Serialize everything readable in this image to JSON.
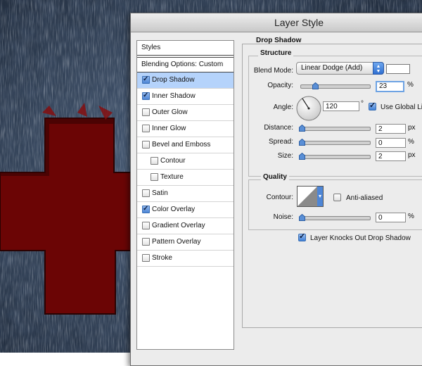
{
  "dialog": {
    "title": "Layer Style"
  },
  "styles_list": {
    "header": "Styles",
    "blending_options": "Blending Options: Custom",
    "items": [
      {
        "label": "Drop Shadow",
        "checked": true,
        "selected": true,
        "indent": false
      },
      {
        "label": "Inner Shadow",
        "checked": true,
        "selected": false,
        "indent": false
      },
      {
        "label": "Outer Glow",
        "checked": false,
        "selected": false,
        "indent": false
      },
      {
        "label": "Inner Glow",
        "checked": false,
        "selected": false,
        "indent": false
      },
      {
        "label": "Bevel and Emboss",
        "checked": false,
        "selected": false,
        "indent": false
      },
      {
        "label": "Contour",
        "checked": false,
        "selected": false,
        "indent": true
      },
      {
        "label": "Texture",
        "checked": false,
        "selected": false,
        "indent": true
      },
      {
        "label": "Satin",
        "checked": false,
        "selected": false,
        "indent": false
      },
      {
        "label": "Color Overlay",
        "checked": true,
        "selected": false,
        "indent": false
      },
      {
        "label": "Gradient Overlay",
        "checked": false,
        "selected": false,
        "indent": false
      },
      {
        "label": "Pattern Overlay",
        "checked": false,
        "selected": false,
        "indent": false
      },
      {
        "label": "Stroke",
        "checked": false,
        "selected": false,
        "indent": false
      }
    ]
  },
  "drop_shadow": {
    "section_title": "Drop Shadow",
    "structure": {
      "title": "Structure",
      "blend_mode_label": "Blend Mode:",
      "blend_mode_value": "Linear Dodge (Add)",
      "shadow_color": "#ffffff",
      "opacity_label": "Opacity:",
      "opacity_value": "23",
      "opacity_unit": "%",
      "angle_label": "Angle:",
      "angle_value": "120",
      "angle_unit": "°",
      "use_global_light_label": "Use Global Li",
      "use_global_light_checked": true,
      "distance_label": "Distance:",
      "distance_value": "2",
      "distance_unit": "px",
      "spread_label": "Spread:",
      "spread_value": "0",
      "spread_unit": "%",
      "size_label": "Size:",
      "size_value": "2",
      "size_unit": "px"
    },
    "quality": {
      "title": "Quality",
      "contour_label": "Contour:",
      "anti_aliased_label": "Anti-aliased",
      "anti_aliased_checked": false,
      "noise_label": "Noise:",
      "noise_value": "0",
      "noise_unit": "%"
    },
    "knockout_label": "Layer Knocks Out Drop Shadow",
    "knockout_checked": true
  },
  "colors": {
    "selection": "#b5d3fb",
    "cross_red": "#6b0505",
    "dialog_bg": "#ececec"
  },
  "icons": [
    "checkbox-icon",
    "dropdown-arrows-icon",
    "slider-thumb-icon",
    "angle-dial-icon",
    "contour-preview-icon"
  ]
}
